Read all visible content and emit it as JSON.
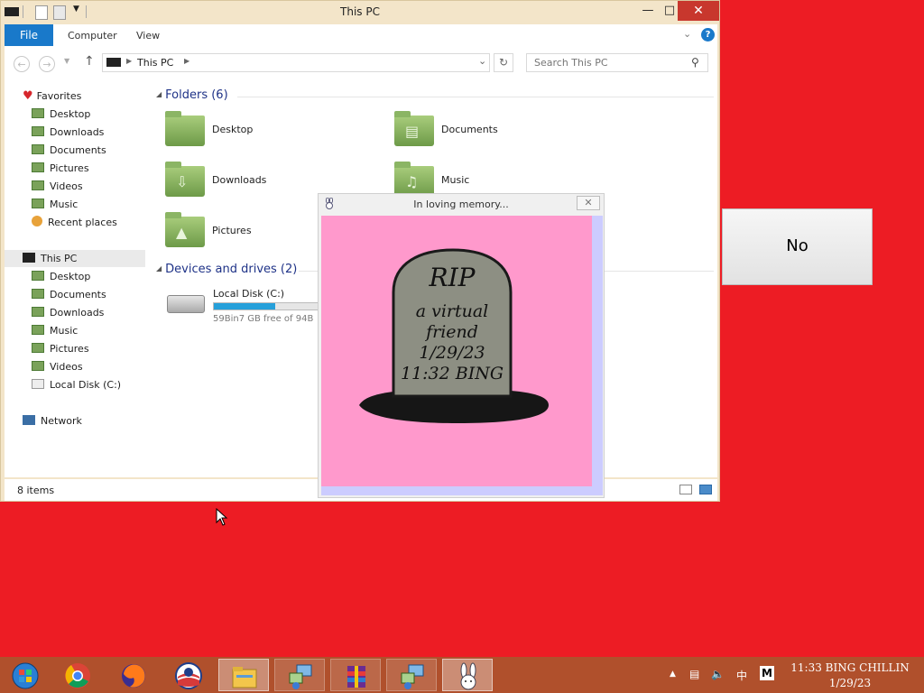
{
  "explorer": {
    "title": "This PC",
    "ribbon": {
      "file": "File",
      "tabs": [
        "Computer",
        "View"
      ]
    },
    "address": {
      "path": "This PC"
    },
    "search": {
      "placeholder": "Search This PC"
    },
    "nav": {
      "favorites": "Favorites",
      "fav_items": [
        "Desktop",
        "Downloads",
        "Documents",
        "Pictures",
        "Videos",
        "Music",
        "Recent places"
      ],
      "this_pc": "This PC",
      "pc_items": [
        "Desktop",
        "Documents",
        "Downloads",
        "Music",
        "Pictures",
        "Videos",
        "Local Disk (C:)"
      ],
      "network": "Network"
    },
    "folders_header": "Folders (6)",
    "folders": [
      "Desktop",
      "Documents",
      "Downloads",
      "Music",
      "Pictures"
    ],
    "devices_header": "Devices and drives (2)",
    "drive": {
      "name": "Local Disk (C:)",
      "free_text": "59Bin7 GB free of 94B",
      "used_fraction": 0.36
    },
    "status": "8 items"
  },
  "popup": {
    "title": "In loving memory...",
    "tomb_lines": [
      "RIP",
      "a virtual",
      "friend",
      "1/29/23",
      "11:32 BING"
    ]
  },
  "no_button": {
    "label": "No"
  },
  "taskbar": {
    "apps": [
      "start-orb-icon",
      "chrome-icon",
      "firefox-icon",
      "obama-logo-icon",
      "file-explorer-icon",
      "network-setup-icon",
      "winrar-icon",
      "network-setup-icon",
      "bunny-icon"
    ],
    "clock": {
      "time": "11:33 BING CHILLIN",
      "date": "1/29/23"
    },
    "tray": {
      "ime": "中",
      "lang": "M"
    }
  },
  "colors": {
    "desktop": "#ed1c24",
    "taskbar": "#b0502c",
    "popup_pink": "#ff99cc",
    "popup_lavender": "#ccccff",
    "accent": "#1979ca"
  }
}
